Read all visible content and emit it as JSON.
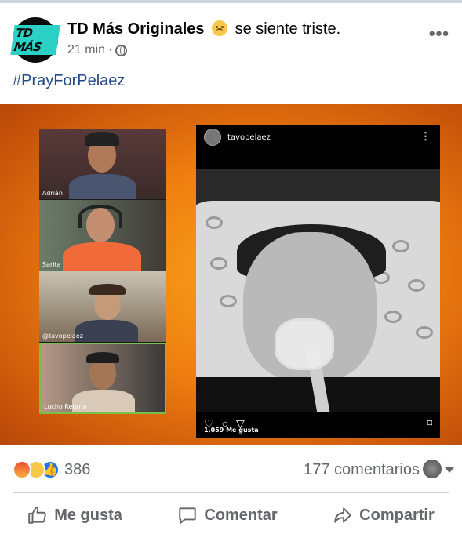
{
  "post": {
    "page_name": "TD Más Originales",
    "feeling": "se siente triste.",
    "logo_text": "TD MÁS",
    "time": "21 min",
    "separator": "·",
    "hashtag": "#PrayForPelaez",
    "more_label": "•••"
  },
  "media": {
    "call_participants": [
      {
        "name": "Adrián"
      },
      {
        "name": "Sarita"
      },
      {
        "name": "@tavopelaez"
      },
      {
        "name": "Lucho Retana"
      }
    ],
    "instagram": {
      "username": "tavopelaez",
      "likes": "1,059 Me gusta"
    }
  },
  "stats": {
    "reaction_icons": [
      "angry-icon",
      "haha-icon",
      "like-icon"
    ],
    "reaction_count": "386",
    "comments": "177 comentarios"
  },
  "actions": {
    "like": "Me gusta",
    "comment": "Comentar",
    "share": "Compartir"
  },
  "colors": {
    "hashtag": "#214a8a",
    "background_orange": "#ef7e10",
    "like_blue": "#1877f2"
  }
}
